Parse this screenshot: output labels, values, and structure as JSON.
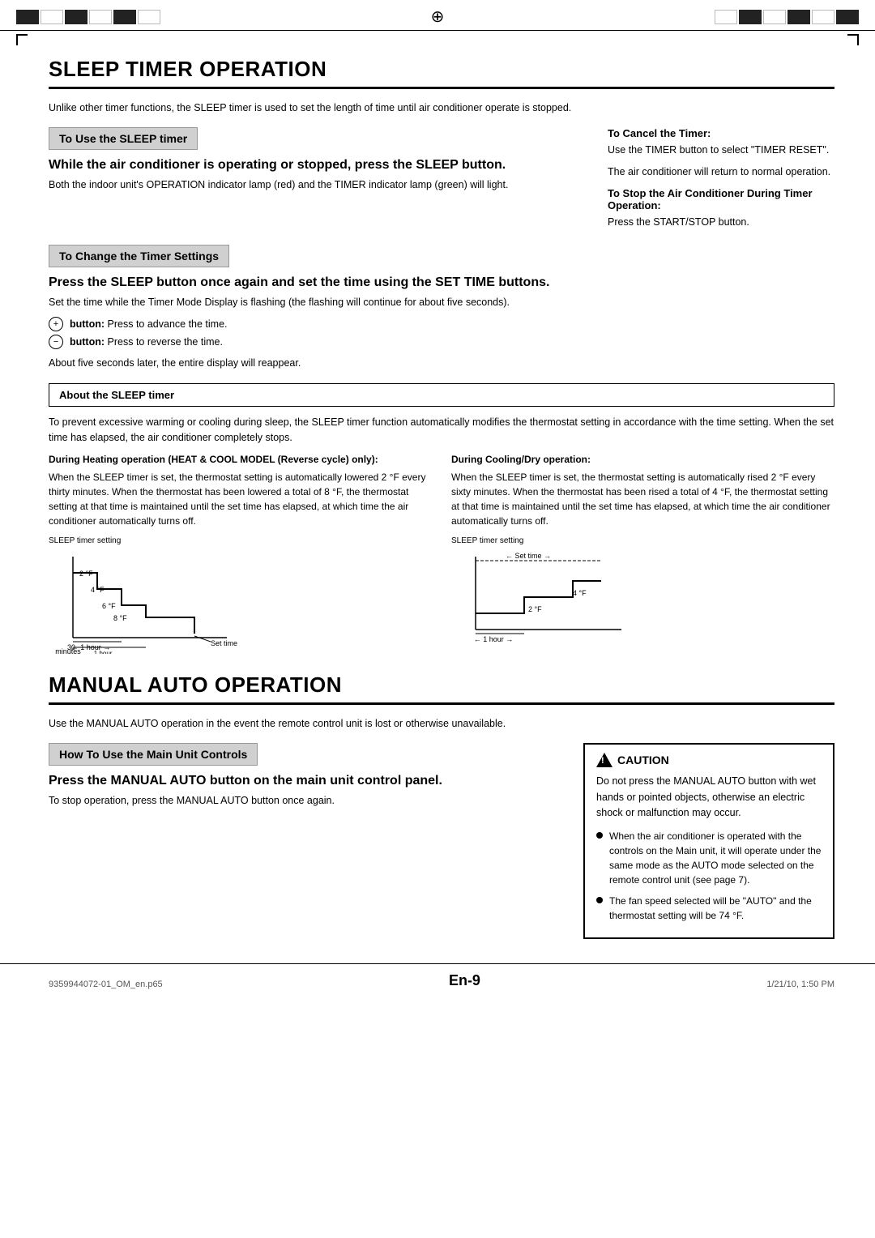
{
  "page": {
    "top_section_title": "SLEEP TIMER OPERATION",
    "bottom_section_title": "MANUAL AUTO OPERATION",
    "page_number": "En-9",
    "footer_left": "9359944072-01_OM_en.p65",
    "footer_center": "9",
    "footer_right": "1/21/10, 1:50 PM"
  },
  "sleep_section": {
    "intro": "Unlike other timer functions, the SLEEP timer is used to set the length of time until air conditioner operate is stopped.",
    "subsection1": {
      "label": "To Use the SLEEP timer",
      "heading": "While the air conditioner is operating or stopped, press the SLEEP button.",
      "body": "Both the indoor unit's OPERATION indicator lamp (red) and the TIMER indicator lamp (green) will light."
    },
    "cancel_timer": {
      "heading": "To Cancel the Timer:",
      "body1": "Use the TIMER button to select \"TIMER RESET\".",
      "body2": "The air conditioner will return to normal operation."
    },
    "stop_ac": {
      "heading": "To Stop the Air Conditioner During Timer Operation:",
      "body": "Press the START/STOP button."
    },
    "subsection2": {
      "label": "To Change the Timer Settings",
      "heading": "Press the SLEEP button once again and set the time using the SET TIME buttons.",
      "body": "Set the time while the Timer Mode Display is flashing (the flashing will continue for about five seconds).",
      "btn_plus_label": "button:",
      "btn_plus_text": "Press to advance the time.",
      "btn_minus_label": "button:",
      "btn_minus_text": "Press to reverse the time.",
      "after_text": "About five seconds later, the entire display will reappear."
    },
    "about_sleep": {
      "title": "About the SLEEP timer",
      "body": "To prevent excessive warming or cooling during sleep, the SLEEP timer function automatically modifies the thermostat setting in accordance with the time setting. When the set time has elapsed, the air conditioner completely stops.",
      "heating_title": "During Heating operation (HEAT & COOL MODEL (Reverse cycle) only):",
      "heating_body": "When the SLEEP timer is set, the thermostat setting is automatically lowered 2 °F every thirty minutes. When the thermostat has been lowered a total of 8 °F, the thermostat setting at that time is maintained until the set time has elapsed, at which time the air conditioner automatically turns off.",
      "heating_diagram_label": "SLEEP timer setting",
      "cooling_title": "During Cooling/Dry operation:",
      "cooling_body": "When the SLEEP timer is set, the thermostat setting is automatically rised 2 °F every sixty minutes. When the thermostat has been rised a total of 4 °F, the thermostat setting at that time is maintained until the set time has elapsed, at which time the air conditioner automatically turns off.",
      "cooling_diagram_label": "SLEEP timer setting"
    }
  },
  "manual_section": {
    "intro": "Use the MANUAL AUTO operation in the event the remote control unit is lost or otherwise unavailable.",
    "subsection": {
      "label": "How To Use the Main Unit Controls",
      "heading": "Press the MANUAL AUTO button on the main unit control panel.",
      "body": "To stop operation, press the MANUAL AUTO button once again."
    },
    "caution": {
      "title": "CAUTION",
      "body": "Do not press the MANUAL AUTO button with wet hands or pointed objects, otherwise an electric shock or malfunction may occur.",
      "bullet1": "When the air conditioner is operated with the controls on the Main unit, it will operate under the same mode as the AUTO mode selected on the remote control unit (see page 7).",
      "bullet2": "The fan speed selected will be \"AUTO\" and the thermostat setting will be 74 °F."
    }
  }
}
